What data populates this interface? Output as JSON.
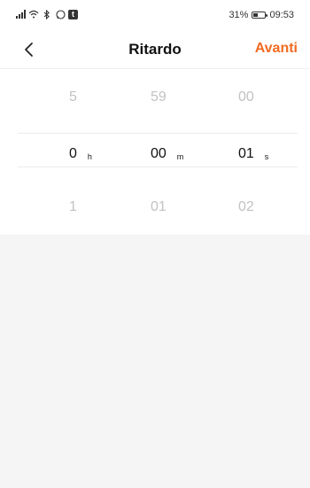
{
  "status_bar": {
    "battery_percent": "31%",
    "time": "09:53",
    "icons": [
      "signal-icon",
      "wifi-icon",
      "bluetooth-icon",
      "whatsapp-icon",
      "app-badge-icon",
      "battery-icon"
    ]
  },
  "nav": {
    "title": "Ritardo",
    "next_label": "Avanti"
  },
  "picker": {
    "hours": {
      "prev": "5",
      "selected": "0",
      "next": "1",
      "unit": "h"
    },
    "minutes": {
      "prev": "59",
      "selected": "00",
      "next": "01",
      "unit": "m"
    },
    "seconds": {
      "prev": "00",
      "selected": "01",
      "next": "02",
      "unit": "s"
    }
  },
  "colors": {
    "accent": "#f26a21",
    "background": "#f5f5f5",
    "panel": "#ffffff"
  }
}
